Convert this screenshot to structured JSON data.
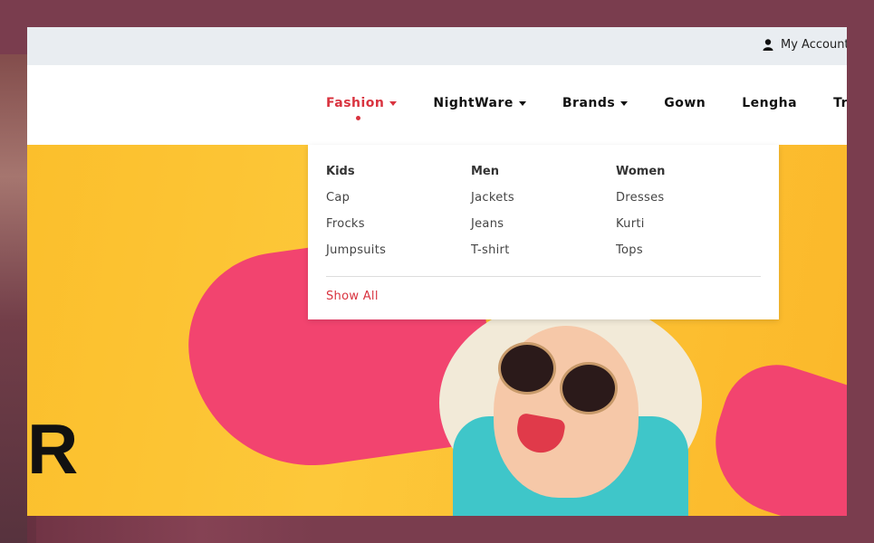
{
  "topbar": {
    "account_label": "My Account"
  },
  "nav": {
    "items": [
      {
        "label": "Fashion",
        "has_caret": true,
        "active": true
      },
      {
        "label": "NightWare",
        "has_caret": true
      },
      {
        "label": "Brands",
        "has_caret": true
      },
      {
        "label": "Gown"
      },
      {
        "label": "Lengha"
      },
      {
        "label": "Trek Pants"
      }
    ]
  },
  "dropdown": {
    "columns": [
      {
        "heading": "Kids",
        "links": [
          "Cap",
          "Frocks",
          "Jumpsuits"
        ]
      },
      {
        "heading": "Men",
        "links": [
          "Jackets",
          "Jeans",
          "T-shirt"
        ]
      },
      {
        "heading": "Women",
        "links": [
          "Dresses",
          "Kurti",
          "Tops"
        ]
      }
    ],
    "show_all": "Show All"
  },
  "hero": {
    "letter": "R"
  },
  "colors": {
    "accent": "#d9333f",
    "topbar": "#e9edf1",
    "hero_bg": "#fdc83a",
    "outer_bg": "#7a3d4e"
  }
}
